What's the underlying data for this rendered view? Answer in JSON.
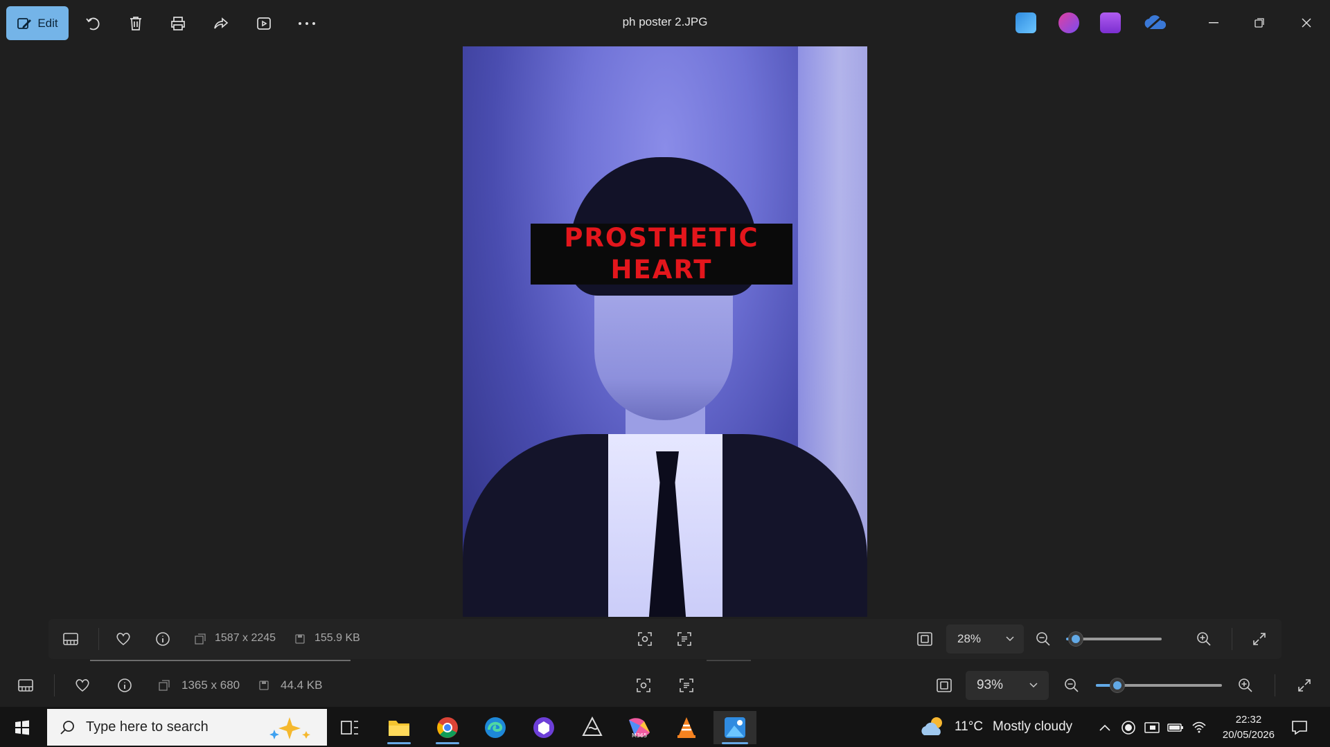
{
  "window": {
    "title": "ph poster 2.JPG",
    "edit_label": "Edit"
  },
  "photo": {
    "banner_line1": "PROSTHETIC",
    "banner_line2": "HEART"
  },
  "info_bar_1": {
    "dimensions": "1587 x 2245",
    "file_size": "155.9 KB",
    "zoom": "28%",
    "zoom_level_percent": 28
  },
  "info_bar_2": {
    "dimensions": "1365 x 680",
    "file_size": "44.4 KB",
    "zoom": "93%",
    "zoom_level_percent": 93
  },
  "taskbar": {
    "search_placeholder": "Type here to search",
    "weather_temp": "11°C",
    "weather_desc": "Mostly cloudy",
    "time": "22:32",
    "date": "20/05/2026"
  },
  "colors": {
    "accent": "#74b4e8",
    "banner_text": "#e3161c"
  }
}
